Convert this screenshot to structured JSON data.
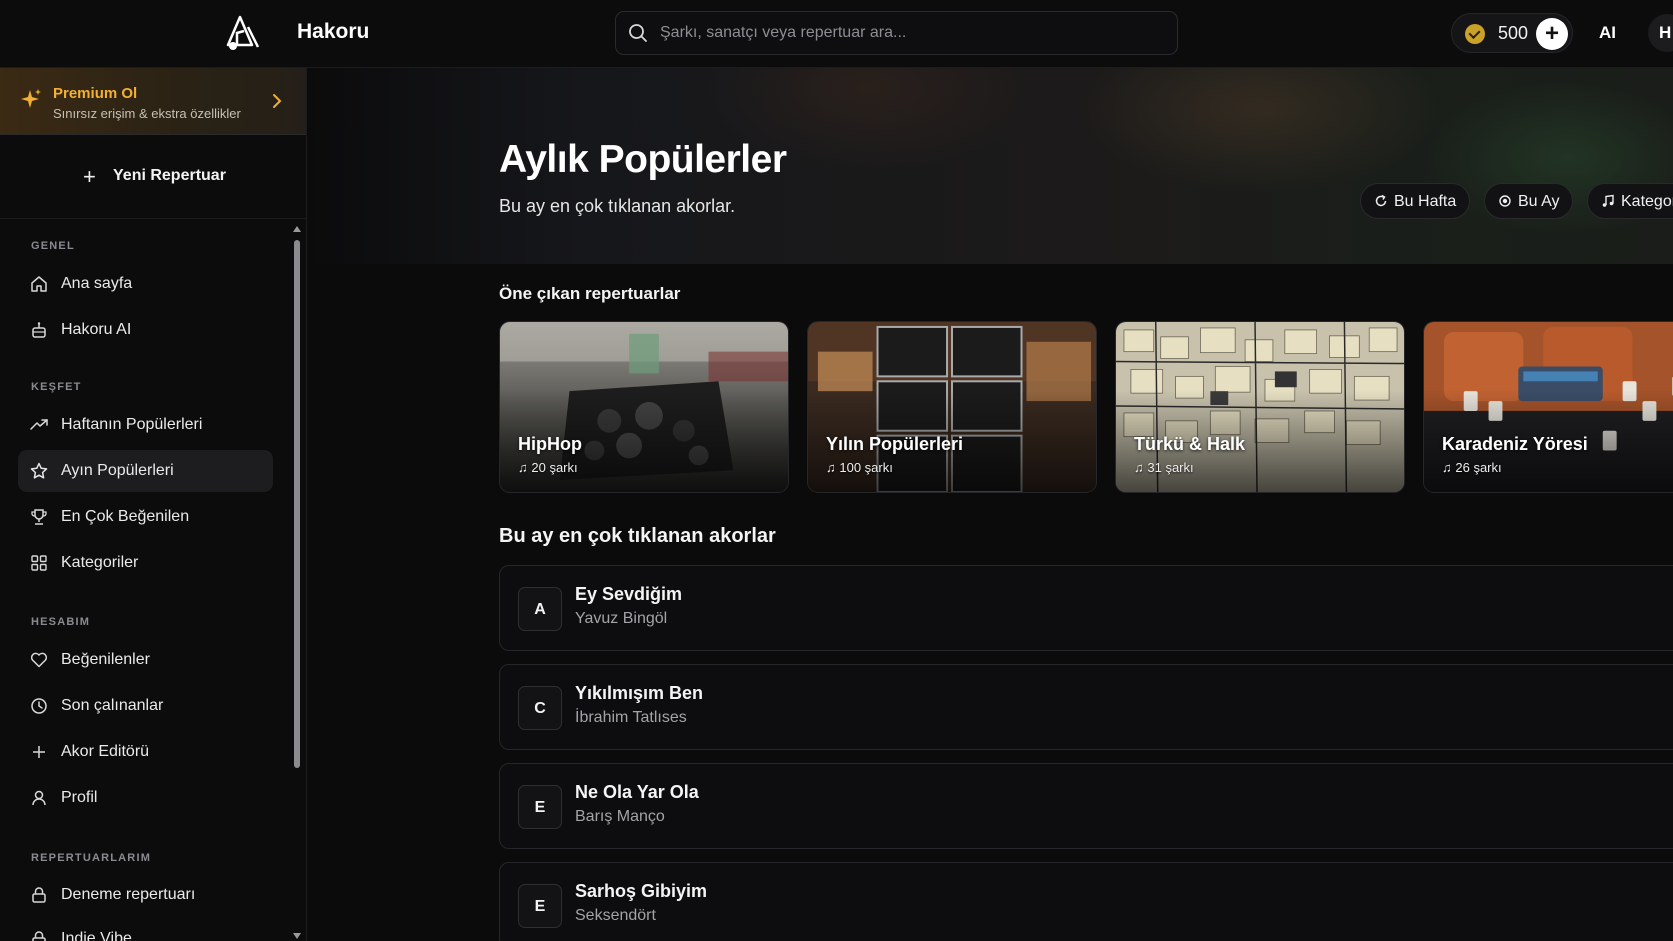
{
  "header": {
    "brand": "Hakoru",
    "search_placeholder": "Şarkı, sanatçı veya repertuar ara...",
    "coins": "500",
    "coin_add": "+",
    "ai_label": "AI",
    "avatar_initial": "H"
  },
  "sidebar": {
    "premium": {
      "title": "Premium Ol",
      "subtitle": "Sınırsız erişim & ekstra özellikler"
    },
    "new_repertoire": "Yeni Repertuar",
    "sections": [
      {
        "title": "GENEL",
        "items": [
          {
            "label": "Ana sayfa",
            "icon": "home-icon"
          },
          {
            "label": "Hakoru AI",
            "icon": "robot-icon"
          }
        ]
      },
      {
        "title": "KEŞFET",
        "items": [
          {
            "label": "Haftanın Popülerleri",
            "icon": "trending-icon"
          },
          {
            "label": "Ayın Popülerleri",
            "icon": "star-icon",
            "active": true
          },
          {
            "label": "En Çok Beğenilen",
            "icon": "trophy-icon"
          },
          {
            "label": "Kategoriler",
            "icon": "grid-icon"
          }
        ]
      },
      {
        "title": "HESABIM",
        "items": [
          {
            "label": "Beğenilenler",
            "icon": "heart-icon"
          },
          {
            "label": "Son çalınanlar",
            "icon": "clock-icon"
          },
          {
            "label": "Akor Editörü",
            "icon": "plus-icon"
          },
          {
            "label": "Profil",
            "icon": "user-icon"
          }
        ]
      },
      {
        "title": "REPERTUARLARIM",
        "items": [
          {
            "label": "Deneme repertuarı",
            "icon": "lock-icon"
          },
          {
            "label": "Indie Vibe",
            "icon": "lock-icon"
          }
        ]
      }
    ]
  },
  "main": {
    "title": "Aylık Popülerler",
    "subtitle": "Bu ay en çok tıklanan akorlar.",
    "chips": [
      {
        "label": "Bu Hafta",
        "icon": "refresh-icon"
      },
      {
        "label": "Bu Ay",
        "icon": "dot-icon"
      },
      {
        "label": "Kategoriler",
        "icon": "music-note-icon"
      }
    ],
    "featured_title": "Öne çıkan repertuarlar",
    "featured": [
      {
        "title": "HipHop",
        "count": "20 şarkı"
      },
      {
        "title": "Yılın Popülerleri",
        "count": "100 şarkı"
      },
      {
        "title": "Türkü & Halk",
        "count": "31 şarkı"
      },
      {
        "title": "Karadeniz Yöresi",
        "count": "26 şarkı"
      }
    ],
    "list_title": "Bu ay en çok tıklanan akorlar",
    "songs": [
      {
        "key": "A",
        "title": "Ey Sevdiğim",
        "artist": "Yavuz Bingöl"
      },
      {
        "key": "C",
        "title": "Yıkılmışım Ben",
        "artist": "İbrahim Tatlıses"
      },
      {
        "key": "E",
        "title": "Ne Ola Yar Ola",
        "artist": "Barış Manço"
      },
      {
        "key": "E",
        "title": "Sarhoş Gibiyim",
        "artist": "Seksendört"
      }
    ]
  },
  "colors": {
    "accent": "#f2b134",
    "background": "#0b0b0c",
    "coin": "#c9a227"
  }
}
